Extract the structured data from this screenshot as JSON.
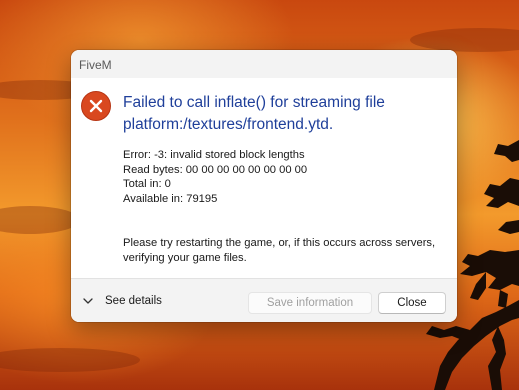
{
  "window": {
    "title": "FiveM"
  },
  "dialog": {
    "icon": "error-icon",
    "heading": "Failed to call inflate() for streaming file platform:/textures/frontend.ytd.",
    "details": [
      "Error: -3: invalid stored block lengths",
      "Read bytes: 00 00 00 00 00 00 00 00",
      "Total in: 0",
      "Available in: 79195"
    ],
    "hint": "Please try restarting the game, or, if this occurs across servers, verifying your game files."
  },
  "footer": {
    "see_details_label": "See details",
    "save_label": "Save information",
    "close_label": "Close"
  },
  "colors": {
    "heading": "#1f3f9a",
    "error_icon": "#d9481f"
  }
}
